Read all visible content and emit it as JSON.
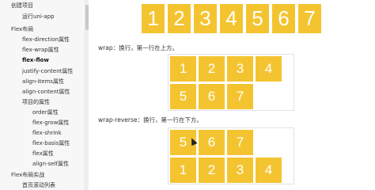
{
  "sidebar": {
    "items": [
      {
        "label": "创建项目"
      },
      {
        "label": "运行uni-app"
      },
      {
        "label": "Flex布局"
      },
      {
        "label": "flex-direction属性"
      },
      {
        "label": "flex-wrap属性"
      },
      {
        "label": "flex-flow"
      },
      {
        "label": "justify-content属性"
      },
      {
        "label": "align-items属性"
      },
      {
        "label": "align-content属性"
      },
      {
        "label": "项目的属性"
      },
      {
        "label": "order属性"
      },
      {
        "label": "flex-grow属性"
      },
      {
        "label": "flex-shrink"
      },
      {
        "label": "flex-basis属性"
      },
      {
        "label": "flex属性"
      },
      {
        "label": "align-self属性"
      },
      {
        "label": "Flex布局实战"
      },
      {
        "label": "首页滚动列表"
      }
    ]
  },
  "top_row": {
    "items": [
      "1",
      "2",
      "3",
      "4",
      "5",
      "6",
      "7"
    ]
  },
  "wrap": {
    "caption": "wrap：换行，第一行在上方。",
    "items": [
      "1",
      "2",
      "3",
      "4",
      "5",
      "6",
      "7"
    ]
  },
  "wrap_reverse": {
    "caption": "wrap-reverse：换行，第一行在下方。",
    "items": [
      "5",
      "6",
      "7",
      "1",
      "2",
      "3",
      "4"
    ]
  },
  "colors": {
    "box": "#f4c430",
    "text": "#ffffff"
  }
}
